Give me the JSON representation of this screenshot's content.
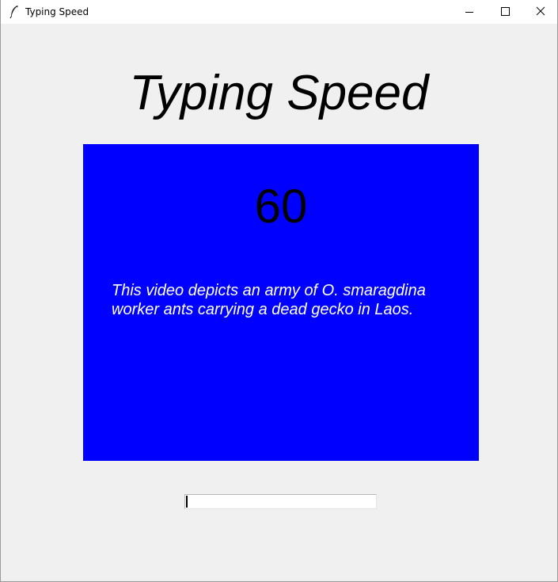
{
  "window": {
    "title": "Typing Speed",
    "icon": "feather-icon",
    "controls": [
      "minimize-icon",
      "maximize-icon",
      "close-icon"
    ]
  },
  "main": {
    "heading": "Typing Speed",
    "timer": "60",
    "sentence": "This video depicts an army of O. smaragdina worker ants carrying a dead gecko in Laos.",
    "sentence_lines": [
      "This video depicts an army of O. smaragdina",
      "worker ants carrying a dead gecko in Laos."
    ],
    "input_value": ""
  },
  "colors": {
    "panel_background": "#0000ff",
    "window_background": "#f0f0f0",
    "sentence_text": "#ffffff",
    "timer_text": "#000000"
  }
}
